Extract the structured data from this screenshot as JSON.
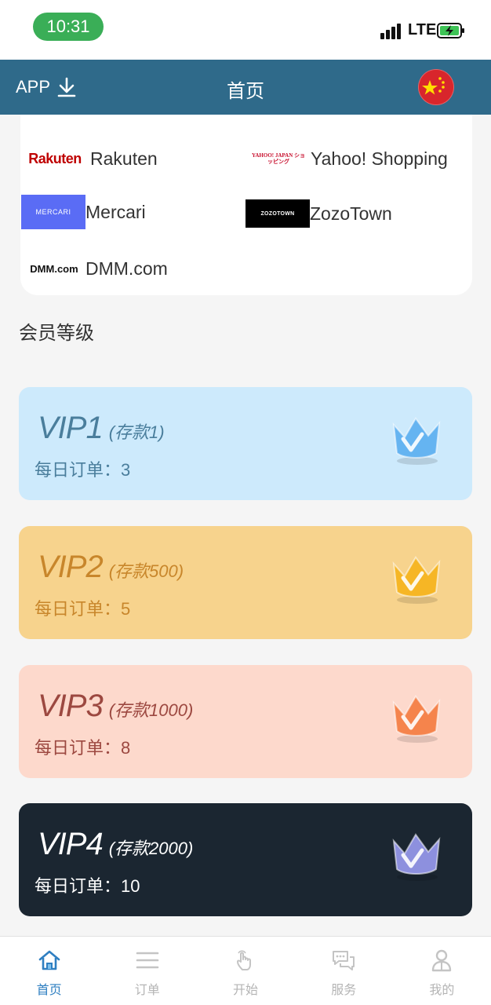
{
  "status_bar": {
    "time": "10:31",
    "network": "LTE"
  },
  "header": {
    "app_label": "APP",
    "title": "首页"
  },
  "platforms": [
    {
      "logo_text": "Rakuten",
      "name": "Rakuten"
    },
    {
      "logo_text": "YAHOO! JAPAN ショッピング",
      "name": "Yahoo! Shopping"
    },
    {
      "logo_text": "MERCARI",
      "name": "Mercari"
    },
    {
      "logo_text": "ZOZOTOWN",
      "name": "ZozoTown"
    },
    {
      "logo_text": "DMM.com",
      "name": "DMM.com"
    }
  ],
  "section_title": "会员等级",
  "vip_levels": [
    {
      "name": "VIP1",
      "deposit": "(存款1)",
      "orders_label": "每日订单：",
      "orders_value": "3",
      "bg_color": "#cdeafc",
      "text_color": "#4a7e9c",
      "crown_color": "#5aaef0"
    },
    {
      "name": "VIP2",
      "deposit": "(存款500)",
      "orders_label": "每日订单：",
      "orders_value": "5",
      "bg_color": "#f7d38d",
      "text_color": "#c8862b",
      "crown_color": "#f5b21a"
    },
    {
      "name": "VIP3",
      "deposit": "(存款1000)",
      "orders_label": "每日订单：",
      "orders_value": "8",
      "bg_color": "#fdd9cc",
      "text_color": "#9c4840",
      "crown_color": "#f47a3e"
    },
    {
      "name": "VIP4",
      "deposit": "(存款2000)",
      "orders_label": "每日订单：",
      "orders_value": "10",
      "bg_color": "#1b2631",
      "text_color": "#ffffff",
      "crown_color": "#9a9cf2"
    }
  ],
  "tabs": [
    {
      "label": "首页",
      "icon": "home-icon",
      "active": true
    },
    {
      "label": "订单",
      "icon": "list-icon",
      "active": false
    },
    {
      "label": "开始",
      "icon": "tap-hand-icon",
      "active": false
    },
    {
      "label": "服务",
      "icon": "chat-icon",
      "active": false
    },
    {
      "label": "我的",
      "icon": "user-icon",
      "active": false
    }
  ],
  "colors": {
    "header_bg": "#2f6a8a",
    "active_tab": "#2f7fc1",
    "inactive_tab": "#b5b5b5",
    "time_pill": "#3aae57"
  }
}
